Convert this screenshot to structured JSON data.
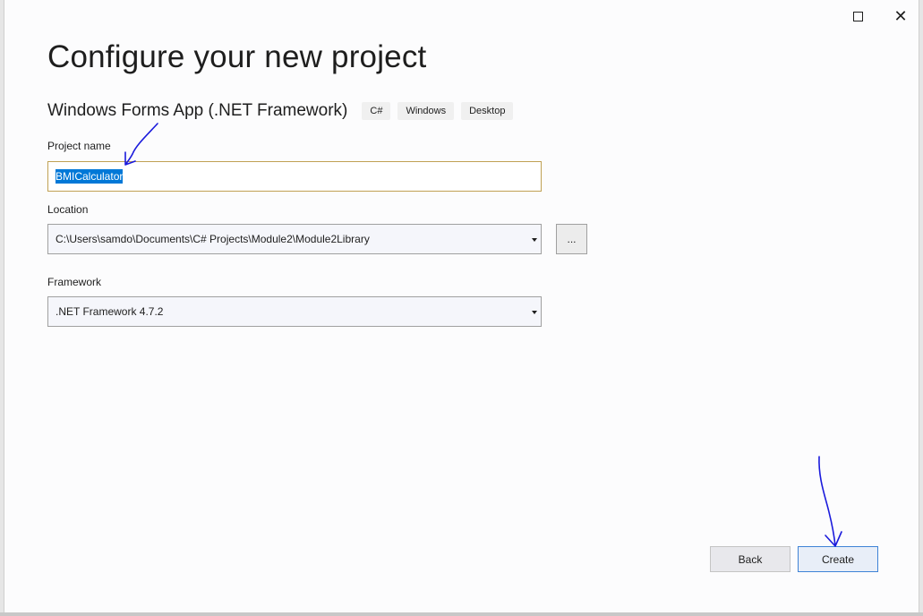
{
  "window": {
    "maximize_icon": "maximize-icon",
    "close_icon": "close-icon",
    "close_glyph": "✕"
  },
  "page": {
    "title": "Configure your new project"
  },
  "template": {
    "name": "Windows Forms App (.NET Framework)",
    "tags": [
      "C#",
      "Windows",
      "Desktop"
    ]
  },
  "project_name": {
    "label": "Project name",
    "value": "BMICalculator"
  },
  "location": {
    "label": "Location",
    "value": "C:\\Users\\samdo\\Documents\\C# Projects\\Module2\\Module2Library",
    "browse_label": "..."
  },
  "framework": {
    "label": "Framework",
    "value": ".NET Framework 4.7.2"
  },
  "footer": {
    "back_label": "Back",
    "create_label": "Create"
  },
  "colors": {
    "selection": "#0078d7",
    "focus_border": "#c0a154",
    "primary_border": "#3f83d6",
    "annotation_ink": "#1a1adc"
  }
}
